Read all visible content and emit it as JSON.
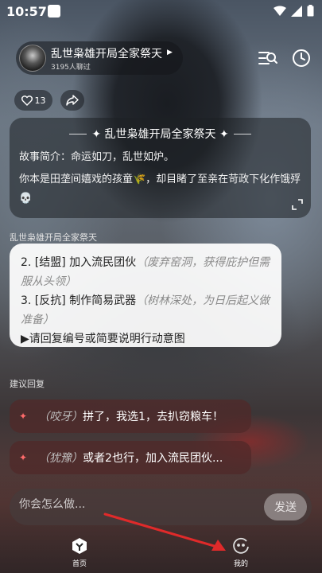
{
  "status": {
    "time": "10:57"
  },
  "header": {
    "title": "乱世枭雄开局全家祭天",
    "subtitle": "3195人聊过",
    "like_count": "13"
  },
  "story": {
    "heading": "✦ 乱世枭雄开局全家祭天 ✦",
    "line1": "故事简介：命运如刀，乱世如炉。",
    "line2": "你本是田垄间嬉戏的孩童🌾，却目睹了至亲在苛政下化作饿殍💀"
  },
  "chat": {
    "speaker": "乱世枭雄开局全家祭天",
    "opt2_label": "2. [结盟] 加入流民团伙",
    "opt2_hint": "（废弃窑洞，获得庇护但需服从头领）",
    "opt3_label": "3. [反抗] 制作简易武器",
    "opt3_hint": "（树林深处，为日后起义做准备）",
    "prompt": "▶请回复编号或简要说明行动意图"
  },
  "suggestions": {
    "label": "建议回复",
    "items": [
      {
        "mood": "（咬牙）",
        "text": "拼了，我选1，去扒窃粮车！"
      },
      {
        "mood": "（犹豫）",
        "text": "或者2也行，加入流民团伙..."
      }
    ]
  },
  "input": {
    "placeholder": "你会怎么做...",
    "send_label": "发送"
  },
  "nav": {
    "home_label": "首页",
    "mine_label": "我的"
  },
  "colors": {
    "accent": "#ff6b6b",
    "arrow": "#e02a2a"
  }
}
